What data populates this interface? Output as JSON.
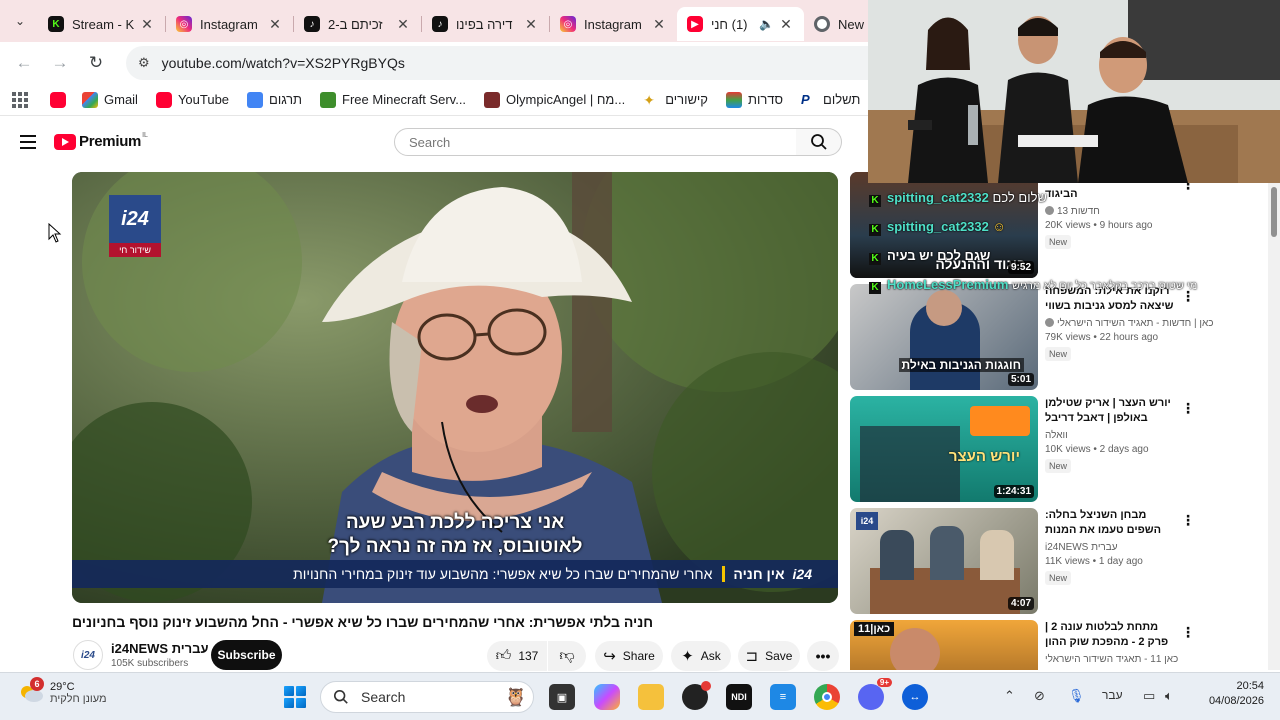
{
  "browser": {
    "tabs": [
      {
        "title": "Stream - K",
        "icon": "kick-icon",
        "active": false
      },
      {
        "title": "Instagram",
        "icon": "instagram-icon",
        "active": false
      },
      {
        "title": "זכיתם ב-2",
        "icon": "tiktok-icon",
        "active": false
      },
      {
        "title": "דירה בפינו",
        "icon": "tiktok-icon",
        "active": false
      },
      {
        "title": "Instagram",
        "icon": "instagram-icon",
        "active": false
      },
      {
        "title": "(1) חני",
        "icon": "youtube-icon",
        "active": true
      },
      {
        "title": "New T",
        "icon": "chrome-icon",
        "active": false
      }
    ],
    "url": "youtube.com/watch?v=XS2PYRgBYQs",
    "bookmarks": [
      {
        "label": "",
        "icon": "youtube-icon"
      },
      {
        "label": "Gmail",
        "icon": "gmail-icon"
      },
      {
        "label": "YouTube",
        "icon": "youtube-icon"
      },
      {
        "label": "תרגום",
        "icon": "translate-icon"
      },
      {
        "label": "Free Minecraft Serv...",
        "icon": "minecraft-icon"
      },
      {
        "label": "OlympicAngel | מח...",
        "icon": "avatar-icon"
      },
      {
        "label": "קישורים",
        "icon": "star-icon"
      },
      {
        "label": "סדרות",
        "icon": "tv-icon"
      },
      {
        "label": "תשלום",
        "icon": "paypal-icon"
      }
    ]
  },
  "youtube": {
    "logo_word": "Premium",
    "country_code": "IL",
    "search_placeholder": "Search"
  },
  "video": {
    "live_badge": "שידור חי",
    "channel_logo": "i24",
    "subtitle_line1": "אני צריכה ללכת רבע שעה",
    "subtitle_line2": "לאוטובוס, אז מה זה נראה לך?",
    "ticker_name": "אין חניה",
    "ticker_text": "אחרי שהמחירים שברו כל שיא אפשרי: מהשבוע עוד זינוק במחירי החנויות",
    "ticker_logo": "i24",
    "title": "חניה בלתי אפשרית: אחרי שהמחירים שברו כל שיא אפשרי - החל מהשבוע זינוק נוסף בחניונים",
    "channel_name": "i24NEWS עברית",
    "subscribers": "105K subscribers",
    "subscribe_label": "Subscribe",
    "likes": "137",
    "share_label": "Share",
    "ask_label": "Ask",
    "save_label": "Save"
  },
  "recommendations": [
    {
      "title": "... ששברו את מחירי הביגוד",
      "channel": "חדשות 13",
      "views": "20K views • 9 hours ago",
      "badge": "New",
      "duration": "9:52",
      "thumb_text": "ביגוד וההנעלה"
    },
    {
      "title": "רוקנו את אילת: המשפחה שיצאה למסע גניבות בשווי של ...",
      "channel": "כאן | חדשות - תאגיד השידור הישראלי",
      "views": "79K views • 22 hours ago",
      "badge": "New",
      "duration": "5:01",
      "thumb_text": "חוגגות הגניבות באילת"
    },
    {
      "title": "יורש העצר | אריק שטילמן באולפן | דאבל דריבל",
      "channel": "וואלה",
      "views": "10K views • 2 days ago",
      "badge": "New",
      "duration": "1:24:31",
      "thumb_text": "יורש העצר"
    },
    {
      "title": "מבחן השניצל בחלה: השפים טעמו את המנות של המוסדות ...",
      "channel": "i24NEWS עברית",
      "views": "11K views • 1 day ago",
      "badge": "New",
      "duration": "4:07",
      "thumb_text": ""
    },
    {
      "title": "מתחת לבלטות עונה 2 | פרק 2 - מהפכת שוק ההון",
      "channel": "כאן 11 - תאגיד השידור הישראלי",
      "views": "",
      "badge": "",
      "duration": "",
      "thumb_text": "כאן|11"
    }
  ],
  "chat": [
    {
      "user": "spitting_cat2332",
      "message": "שלום לכם"
    },
    {
      "user": "spitting_cat2332",
      "message": ""
    },
    {
      "user": "",
      "message": "שגם לכם יש בעיה"
    },
    {
      "user": "HomeLessPremium",
      "message": "מי שטוס ברכב בקלאבר כל יום לא מרגיש"
    }
  ],
  "taskbar": {
    "notification_count": "6",
    "temperature": "29°C",
    "weather_desc": "מעונן חלקית",
    "search_label": "Search",
    "language": "עבר",
    "time": "20:54",
    "date": "04/08/2026",
    "discord_badge": "9+"
  }
}
